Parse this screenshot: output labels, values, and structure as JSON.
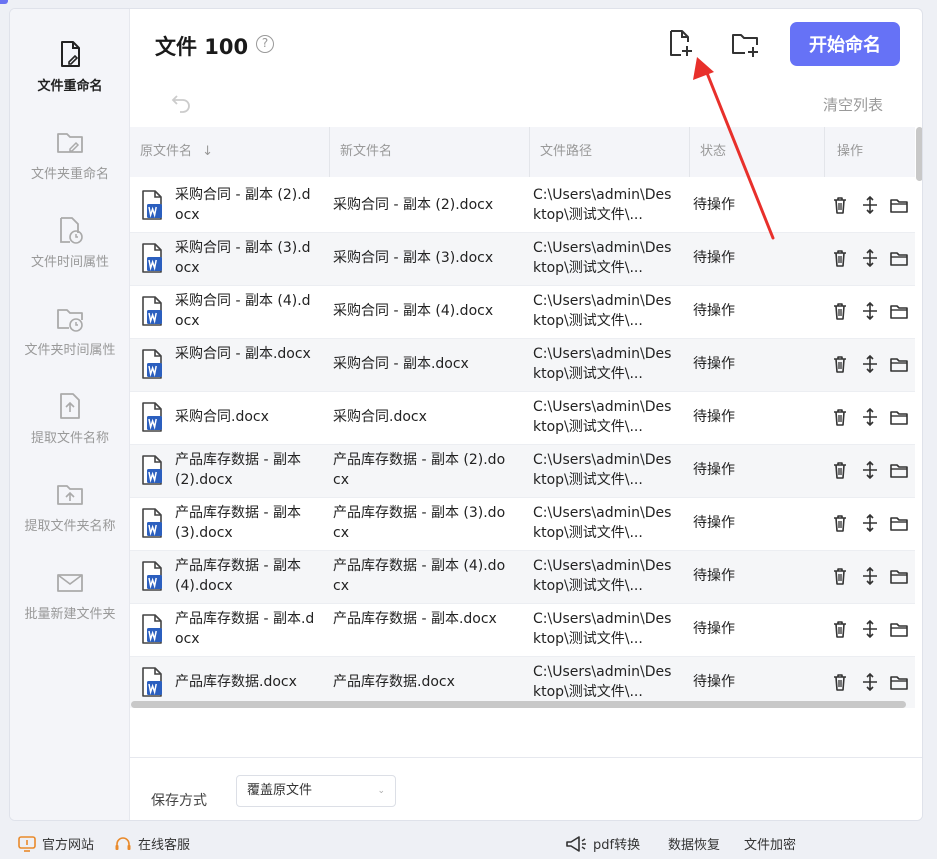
{
  "sidebar": {
    "items": [
      {
        "label": "文件重命名",
        "icon": "file-edit-icon"
      },
      {
        "label": "文件夹重命名",
        "icon": "folder-edit-icon"
      },
      {
        "label": "文件时间属性",
        "icon": "file-clock-icon"
      },
      {
        "label": "文件夹时间属性",
        "icon": "folder-clock-icon"
      },
      {
        "label": "提取文件名称",
        "icon": "file-upload-icon"
      },
      {
        "label": "提取文件夹名称",
        "icon": "folder-upload-icon"
      },
      {
        "label": "批量新建文件夹",
        "icon": "folder-new-icon"
      }
    ]
  },
  "header": {
    "title": "文件 100",
    "help_icon": "question-circle-icon",
    "add_file_icon": "file-add-icon",
    "add_folder_icon": "folder-add-icon",
    "start_label": "开始命名",
    "clear_label": "清空列表",
    "undo_icon": "undo-icon"
  },
  "table": {
    "headers": {
      "original": "原文件名",
      "new": "新文件名",
      "path": "文件路径",
      "status": "状态",
      "actions": "操作"
    },
    "sort_icon": "arrow-down-icon",
    "action_icons": [
      "trash-icon",
      "move-icon",
      "folder-open-icon"
    ],
    "rows": [
      {
        "orig": "采购合同 - 副本 (2).docx",
        "new": "采购合同 - 副本 (2).docx",
        "path": "C:\\Users\\admin\\Desktop\\测试文件\\...",
        "status": "待操作"
      },
      {
        "orig": "采购合同 - 副本 (3).docx",
        "new": "采购合同 - 副本 (3).docx",
        "path": "C:\\Users\\admin\\Desktop\\测试文件\\...",
        "status": "待操作"
      },
      {
        "orig": "采购合同 - 副本 (4).docx",
        "new": "采购合同 - 副本 (4).docx",
        "path": "C:\\Users\\admin\\Desktop\\测试文件\\...",
        "status": "待操作"
      },
      {
        "orig": "采购合同 - 副本.docx",
        "new": "采购合同 - 副本.docx",
        "path": "C:\\Users\\admin\\Desktop\\测试文件\\...",
        "status": "待操作"
      },
      {
        "orig": "采购合同.docx",
        "new": "采购合同.docx",
        "path": "C:\\Users\\admin\\Desktop\\测试文件\\...",
        "status": "待操作"
      },
      {
        "orig": "产品库存数据 - 副本 (2).docx",
        "new": "产品库存数据 - 副本 (2).docx",
        "path": "C:\\Users\\admin\\Desktop\\测试文件\\...",
        "status": "待操作"
      },
      {
        "orig": "产品库存数据 - 副本 (3).docx",
        "new": "产品库存数据 - 副本 (3).docx",
        "path": "C:\\Users\\admin\\Desktop\\测试文件\\...",
        "status": "待操作"
      },
      {
        "orig": "产品库存数据 - 副本 (4).docx",
        "new": "产品库存数据 - 副本 (4).docx",
        "path": "C:\\Users\\admin\\Desktop\\测试文件\\...",
        "status": "待操作"
      },
      {
        "orig": "产品库存数据 - 副本.docx",
        "new": "产品库存数据 - 副本.docx",
        "path": "C:\\Users\\admin\\Desktop\\测试文件\\...",
        "status": "待操作"
      },
      {
        "orig": "产品库存数据.docx",
        "new": "产品库存数据.docx",
        "path": "C:\\Users\\admin\\Desktop\\测试文件\\...",
        "status": "待操作"
      }
    ]
  },
  "bottom": {
    "save_label": "保存方式",
    "save_value": "覆盖原文件"
  },
  "footer": {
    "website": "官方网站",
    "support": "在线客服",
    "pdf": "pdf转换",
    "recovery": "数据恢复",
    "encrypt": "文件加密"
  },
  "colors": {
    "accent": "#6672f6",
    "arrow": "#e8302b"
  }
}
